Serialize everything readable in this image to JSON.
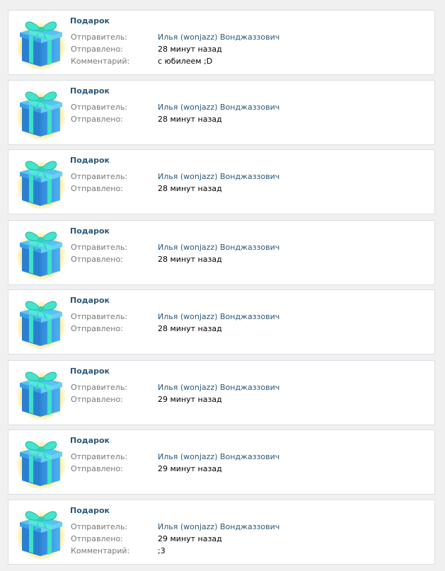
{
  "gifts": [
    {
      "title": "Подарок",
      "sender_label": "Отправитель:",
      "sender": "Илья (wonjazz) Вонджаззович",
      "sent_label": "Отправлено:",
      "sent": "28 минут назад",
      "comment_label": "Комментарий:",
      "comment": "с юбилеем ;D"
    },
    {
      "title": "Подарок",
      "sender_label": "Отправитель:",
      "sender": "Илья (wonjazz) Вонджаззович",
      "sent_label": "Отправлено:",
      "sent": "28 минут назад"
    },
    {
      "title": "Подарок",
      "sender_label": "Отправитель:",
      "sender": "Илья (wonjazz) Вонджаззович",
      "sent_label": "Отправлено:",
      "sent": "28 минут назад"
    },
    {
      "title": "Подарок",
      "sender_label": "Отправитель:",
      "sender": "Илья (wonjazz) Вонджаззович",
      "sent_label": "Отправлено:",
      "sent": "28 минут назад"
    },
    {
      "title": "Подарок",
      "sender_label": "Отправитель:",
      "sender": "Илья (wonjazz) Вонджаззович",
      "sent_label": "Отправлено:",
      "sent": "28 минут назад"
    },
    {
      "title": "Подарок",
      "sender_label": "Отправитель:",
      "sender": "Илья (wonjazz) Вонджаззович",
      "sent_label": "Отправлено:",
      "sent": "29 минут назад"
    },
    {
      "title": "Подарок",
      "sender_label": "Отправитель:",
      "sender": "Илья (wonjazz) Вонджаззович",
      "sent_label": "Отправлено:",
      "sent": "29 минут назад"
    },
    {
      "title": "Подарок",
      "sender_label": "Отправитель:",
      "sender": "Илья (wonjazz) Вонджаззович",
      "sent_label": "Отправлено:",
      "sent": "29 минут назад",
      "comment_label": "Комментарий:",
      "comment": ";3"
    }
  ],
  "icon": "gift-box-icon",
  "colors": {
    "page_background": "#f0f0f0",
    "card_background": "#ffffff",
    "card_border": "#dbdfe4",
    "title": "#2b587a",
    "label": "#777777",
    "link": "#2b587a",
    "value": "#000000",
    "gift_box": "#3aa0e8",
    "gift_ribbon": "#3fe0c8",
    "gift_glow": "#ffe680"
  }
}
